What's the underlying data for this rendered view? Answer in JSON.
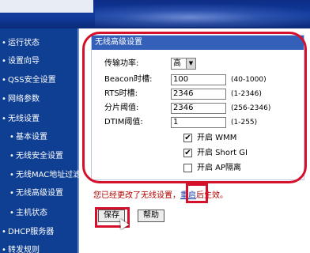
{
  "sidebar": {
    "items": [
      {
        "label": "运行状态"
      },
      {
        "label": "设置向导"
      },
      {
        "label": "QSS安全设置"
      },
      {
        "label": "网络参数"
      },
      {
        "label": "无线设置"
      },
      {
        "label": "基本设置"
      },
      {
        "label": "无线安全设置"
      },
      {
        "label": "无线MAC地址过滤"
      },
      {
        "label": "无线高级设置"
      },
      {
        "label": "主机状态"
      },
      {
        "label": "DHCP服务器"
      },
      {
        "label": "转发规则"
      }
    ]
  },
  "panel": {
    "title": "无线高级设置",
    "tx_power": {
      "label": "传输功率:",
      "value": "高"
    },
    "beacon": {
      "label": "Beacon时槽:",
      "value": "100",
      "range": "(40-1000)"
    },
    "rts": {
      "label": "RTS时槽:",
      "value": "2346",
      "range": "(1-2346)"
    },
    "frag": {
      "label": "分片阈值:",
      "value": "2346",
      "range": "(256-2346)"
    },
    "dtim": {
      "label": "DTIM阈值:",
      "value": "1",
      "range": "(1-255)"
    },
    "wmm": {
      "label": "开启 WMM",
      "checked": true
    },
    "short_gi": {
      "label": "开启 Short GI",
      "checked": true
    },
    "ap_isolation": {
      "label": "开启 AP隔离",
      "checked": false
    }
  },
  "notice": {
    "before": "您已经更改了无线设置，",
    "link": "重启",
    "after": "后生效。"
  },
  "buttons": {
    "save": "保存",
    "help": "帮助"
  },
  "colors": {
    "annotation": "#d4102a",
    "sidebar_bg": "#0f3f92",
    "panel_title_bg": "#3560b9"
  }
}
